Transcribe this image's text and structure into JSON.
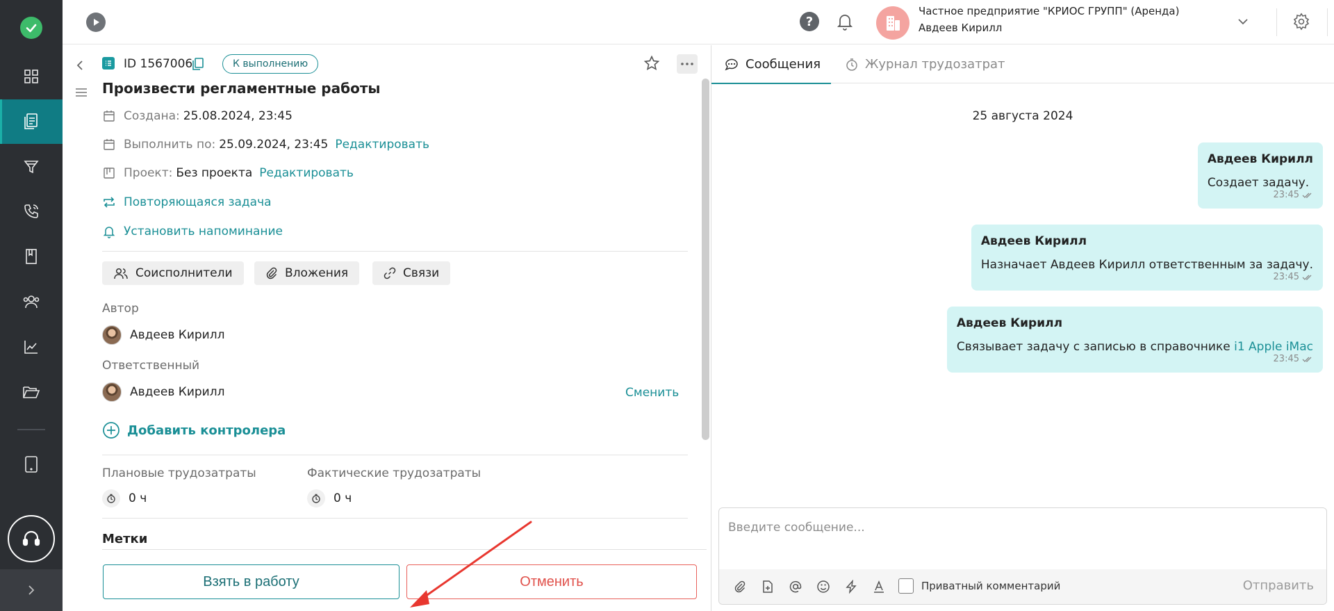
{
  "sidebar": {
    "items": [
      {
        "icon": "dashboard-icon"
      },
      {
        "icon": "tasks-icon"
      },
      {
        "icon": "filter-icon"
      },
      {
        "icon": "phone-icon"
      },
      {
        "icon": "book-icon"
      },
      {
        "icon": "users-icon"
      },
      {
        "icon": "chart-icon"
      },
      {
        "icon": "folder-icon"
      },
      {
        "icon": "tablet-icon"
      }
    ],
    "active_item": "tasks",
    "accent_color": "#107c84"
  },
  "header": {
    "org_name": "Частное предприятие \"КРИОС ГРУПП\" (Аренда)",
    "user_name": "Авдеев Кирилл",
    "avatar_color": "#f4a4a0"
  },
  "task": {
    "id": "ID 1567006",
    "status": "К выполнению",
    "title": "Произвести регламентные работы",
    "created_label": "Создана:",
    "created_value": "25.08.2024, 23:45",
    "due_label": "Выполнить по:",
    "due_value": "25.09.2024, 23:45",
    "edit_label": "Редактировать",
    "project_label": "Проект:",
    "project_value": "Без проекта",
    "recurring_label": "Повторяющаяся задача",
    "reminder_label": "Установить напоминание",
    "chips": {
      "coexecutors": "Соисполнители",
      "attachments": "Вложения",
      "links": "Связи"
    },
    "author_label": "Автор",
    "author_name": "Авдеев Кирилл",
    "responsible_label": "Ответственный",
    "responsible_name": "Авдеев Кирилл",
    "change_label": "Сменить",
    "add_controller_label": "Добавить контролера",
    "planned_label": "Плановые трудозатраты",
    "planned_value": "0 ч",
    "actual_label": "Фактические трудозатраты",
    "actual_value": "0 ч",
    "tags_label": "Метки",
    "take_button": "Взять в работу",
    "cancel_button": "Отменить"
  },
  "chat": {
    "tabs": {
      "messages": "Сообщения",
      "journal": "Журнал трудозатрат"
    },
    "date": "25 августа 2024",
    "messages": [
      {
        "author": "Авдеев Кирилл",
        "text": "Создает задачу.",
        "time": "23:45"
      },
      {
        "author": "Авдеев Кирилл",
        "text": "Назначает Авдеев Кирилл ответственным за задачу.",
        "time": "23:45"
      },
      {
        "author": "Авдеев Кирилл",
        "text": "Связывает задачу с записью в справочнике ",
        "link": "i1 Apple iMac",
        "time": "23:45"
      }
    ],
    "composer": {
      "placeholder": "Введите сообщение...",
      "private_label": "Приватный комментарий",
      "send_label": "Отправить"
    },
    "bubble_color": "#d3f4f4"
  }
}
